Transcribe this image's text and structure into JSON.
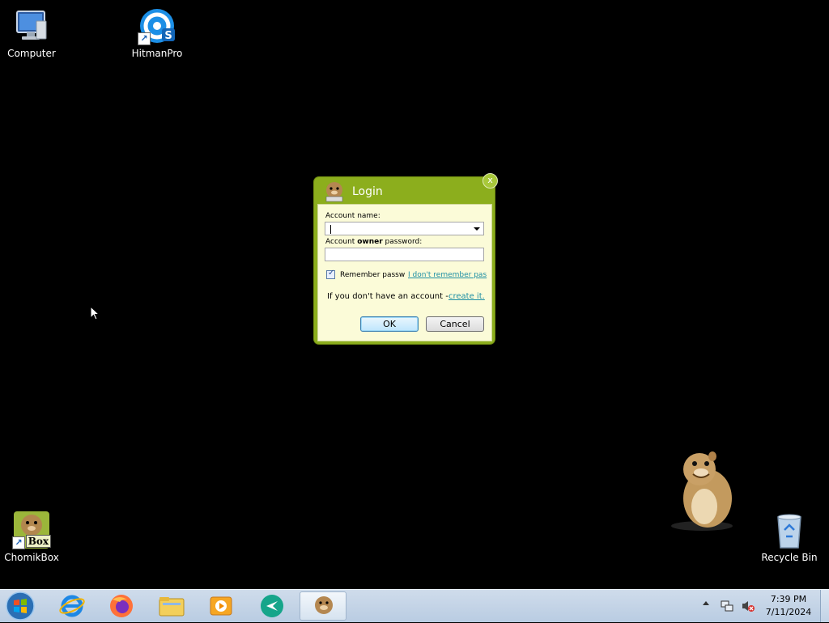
{
  "desktop": {
    "icons": [
      {
        "label": "Computer",
        "icon": "computer-icon"
      },
      {
        "label": "HitmanPro",
        "icon": "hitmanpro-icon"
      },
      {
        "label": "ChomikBox",
        "icon": "chomikbox-icon",
        "badge": "Box"
      },
      {
        "label": "Recycle Bin",
        "icon": "recycle-bin-icon"
      }
    ]
  },
  "dialog": {
    "title": "Login",
    "close_label": "x",
    "account_name_label": "Account name:",
    "password_label_prefix": "Account",
    "password_label_bold": "owner",
    "password_label_suffix": "password:",
    "account_name_value": "",
    "password_value": "",
    "remember_label": "Remember passw",
    "remember_checked": true,
    "forgot_link": "I don't remember pas",
    "no_account_text": "If you don't have an account -",
    "create_link": "create it.",
    "ok_label": "OK",
    "cancel_label": "Cancel",
    "accent_color": "#8cae1d"
  },
  "taskbar": {
    "pinned": [
      "windows-start-icon",
      "internet-explorer-icon",
      "firefox-icon",
      "file-explorer-icon",
      "media-player-icon",
      "chrome-remote-icon",
      "chomikbox-icon"
    ],
    "time": "7:39 PM",
    "date": "7/11/2024"
  }
}
